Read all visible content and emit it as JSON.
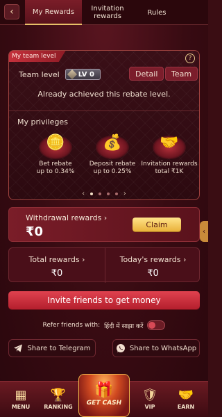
{
  "tabs": [
    {
      "label": "My Rewards",
      "active": true
    },
    {
      "label": "Invitation rewards",
      "active": false
    },
    {
      "label": "Rules",
      "active": false
    }
  ],
  "back_icon": "‹",
  "team": {
    "ribbon": "My team level",
    "help_icon": "?",
    "label": "Team level",
    "level_badge": "LV 0",
    "detail_button": "Detail",
    "team_button": "Team",
    "status": "Already achieved this rebate level."
  },
  "privileges": {
    "title": "My privileges",
    "items": [
      {
        "icon": "coin-stack-icon",
        "line1": "Bet rebate",
        "line2": "up to 0.34%"
      },
      {
        "icon": "money-bag-icon",
        "line1": "Deposit rebate",
        "line2": "up to 0.25%"
      },
      {
        "icon": "handshake-icon",
        "line1": "Invitation rewards",
        "line2": "total ₹1K"
      }
    ],
    "prev_arrow": "‹",
    "next_arrow": "›",
    "dots": 4,
    "active_dot": 0
  },
  "withdrawal": {
    "label": "Withdrawal rewards ›",
    "amount": "₹0",
    "claim_button": "Claim"
  },
  "side_tab_icon": "‹",
  "totals": {
    "total_label": "Total rewards ›",
    "total_value": "₹0",
    "today_label": "Today's rewards ›",
    "today_value": "₹0"
  },
  "invite_button": "Invite friends to get money",
  "refer": {
    "label": "Refer friends with:",
    "hindi_label": "हिंदी में साझा करें",
    "toggle_on": false
  },
  "share": {
    "telegram": "Share to Telegram",
    "whatsapp": "Share to WhatsApp"
  },
  "nav": {
    "menu": "MENU",
    "ranking": "RANKING",
    "get_cash": "GET CASH",
    "vip": "VIP",
    "earn": "EARN"
  },
  "colors": {
    "background": "#380b12",
    "accent_red": "#b41f2d",
    "gold": "#e9b13a"
  }
}
